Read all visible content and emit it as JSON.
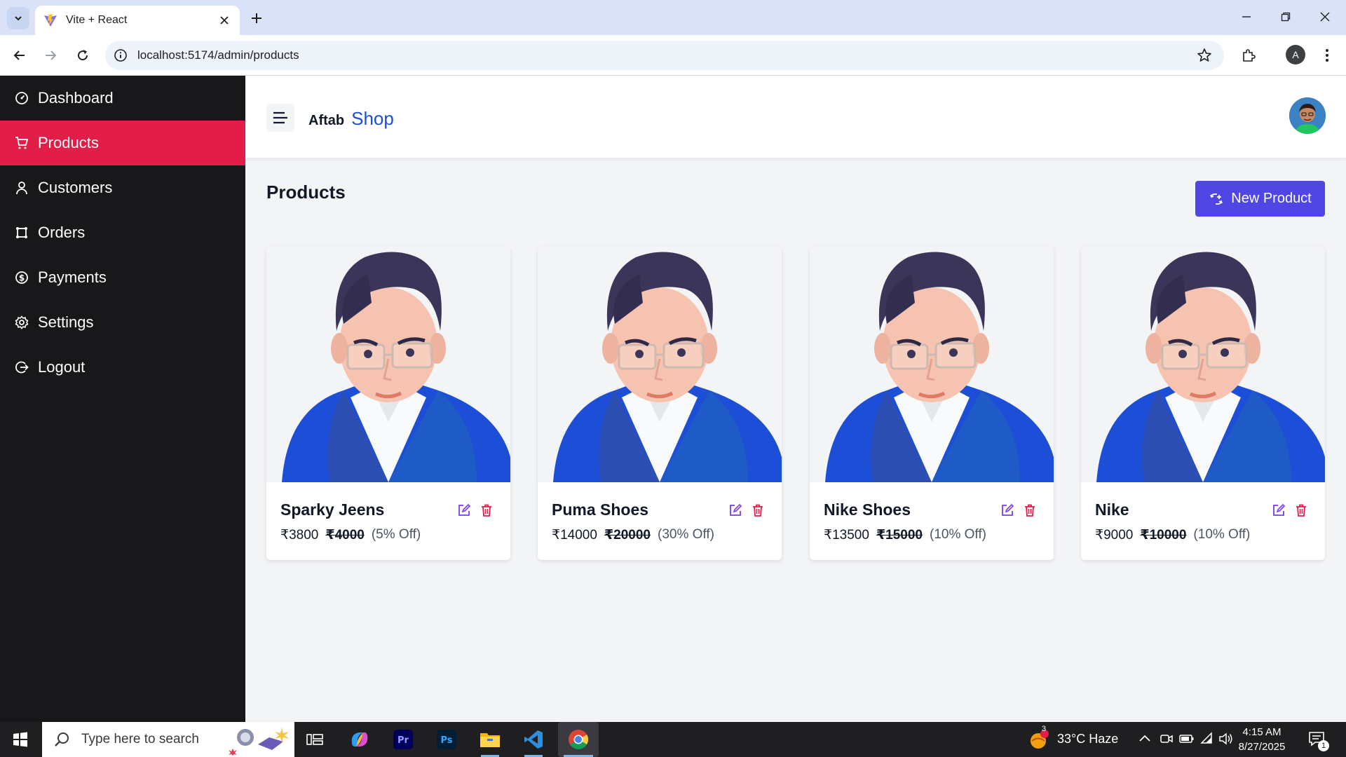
{
  "browser": {
    "tab_title": "Vite + React",
    "url": "localhost:5174/admin/products",
    "profile_initial": "A"
  },
  "sidebar": {
    "items": [
      {
        "label": "Dashboard",
        "icon": "dashboard-icon",
        "active": false
      },
      {
        "label": "Products",
        "icon": "cart-icon",
        "active": true
      },
      {
        "label": "Customers",
        "icon": "user-icon",
        "active": false
      },
      {
        "label": "Orders",
        "icon": "orders-icon",
        "active": false
      },
      {
        "label": "Payments",
        "icon": "dollar-icon",
        "active": false
      },
      {
        "label": "Settings",
        "icon": "gear-icon",
        "active": false
      },
      {
        "label": "Logout",
        "icon": "logout-icon",
        "active": false
      }
    ],
    "active_color": "#e11d48"
  },
  "header": {
    "brand_first": "Aftab",
    "brand_second": "Shop"
  },
  "main": {
    "title": "Products",
    "new_button_label": "New Product",
    "products": [
      {
        "name": "Sparky Jeens",
        "price": "₹3800",
        "original": "₹4000",
        "discount": "(5% Off)"
      },
      {
        "name": "Puma Shoes",
        "price": "₹14000",
        "original": "₹20000",
        "discount": "(30% Off)"
      },
      {
        "name": "Nike Shoes",
        "price": "₹13500",
        "original": "₹15000",
        "discount": "(10% Off)"
      },
      {
        "name": "Nike",
        "price": "₹9000",
        "original": "₹10000",
        "discount": "(10% Off)"
      }
    ]
  },
  "taskbar": {
    "search_placeholder": "Type here to search",
    "weather": "33°C  Haze",
    "weather_badge": "3",
    "time": "4:15 AM",
    "date": "8/27/2025",
    "notification_count": "1"
  },
  "colors": {
    "accent": "#4f46e5",
    "brand": "#1d4ed8",
    "delete": "#e11d48",
    "edit": "#7c3aed"
  }
}
